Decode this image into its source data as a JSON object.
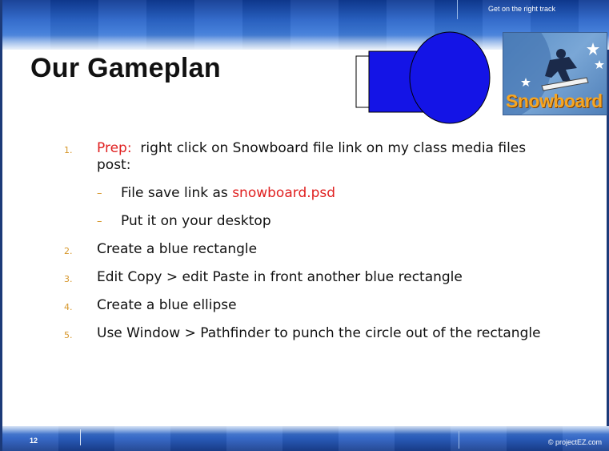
{
  "header": {
    "tagline": "Get on the right track"
  },
  "title": "Our Gameplan",
  "logo": {
    "text": "Snowboard"
  },
  "list": {
    "item1": {
      "num": "1.",
      "prep": "Prep:",
      "text": "  right click on Snowboard file link on my class media files post:"
    },
    "sub1": {
      "dash": "–",
      "text_before": "File save link as ",
      "filename": "snowboard.psd"
    },
    "sub2": {
      "dash": "–",
      "text": "Put it on your desktop"
    },
    "item2": {
      "num": "2.",
      "text": "Create a blue rectangle"
    },
    "item3": {
      "num": "3.",
      "text": "Edit Copy > edit Paste in front another blue rectangle"
    },
    "item4": {
      "num": "4.",
      "text": "Create a blue ellipse"
    },
    "item5": {
      "num": "5.",
      "text": "Use Window > Pathfinder to punch the circle out of the rectangle"
    }
  },
  "footer": {
    "page_number": "12",
    "copyright": "© projectEZ.com"
  },
  "colors": {
    "accent_red": "#e02020",
    "bullet_orange": "#d6962a",
    "band_blue": "#2a5fc2",
    "shape_blue": "#1414e6"
  }
}
